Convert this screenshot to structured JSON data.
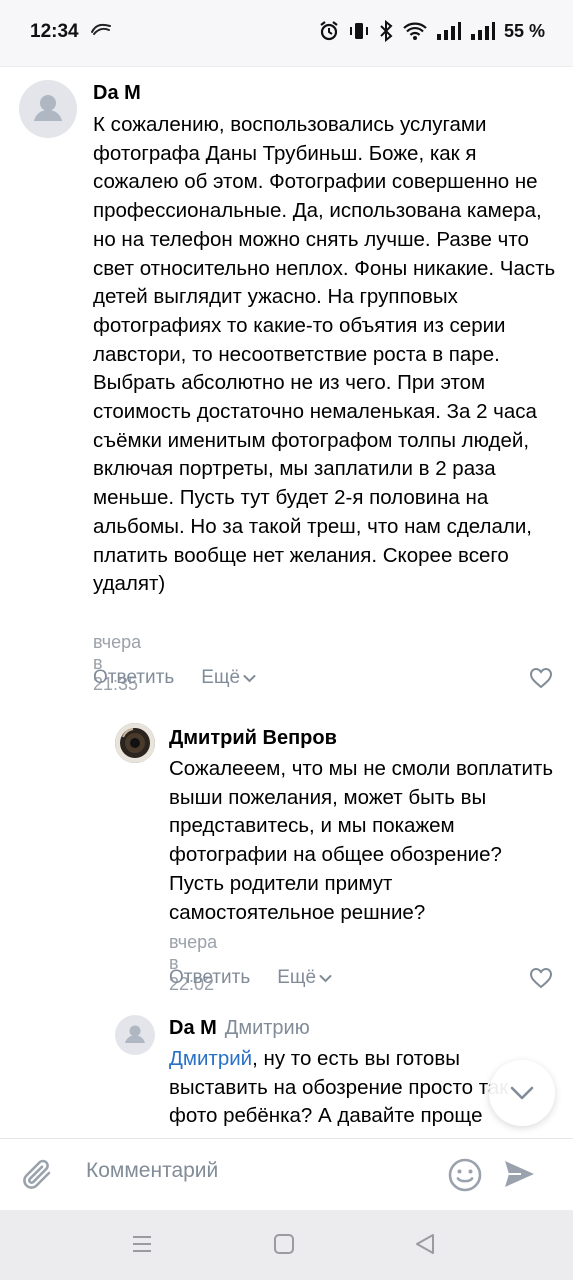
{
  "status_bar": {
    "time": "12:34",
    "battery": "55 %"
  },
  "comments": [
    {
      "author": "Da M",
      "text": "К сожалению, воспользовались услугами фотографа Даны Трубиньш. Боже, как я сожалею об этом. Фотографии совершенно не профессиональные. Да, использована камера, но на телефон можно снять лучше. Разве что свет относительно неплох. Фоны никакие. Часть детей выглядит ужасно. На групповых фотографиях то какие-то объятия из серии лавстори, то несоответствие роста в паре. Выбрать абсолютно не из чего. При этом стоимость достаточно немаленькая. За 2 часа съёмки именитым фотографом толпы людей, включая портреты, мы заплатили в 2 раза меньше. Пусть тут будет 2-я половина на альбомы. Но за такой треш, что нам сделали, платить вообще нет желания. Скорее всего удалят)",
      "time": "вчера в 21:35",
      "reply_label": "Ответить",
      "more_label": "Ещё"
    },
    {
      "author": "Дмитрий Вепров",
      "text": "Сожалееем, что мы не смоли воплатить выши пожелания, может быть вы представитесь, и мы покажем фотографии на общее обозрение? Пусть родители примут самостоятельное решние?",
      "time": "вчера в 22:02",
      "reply_label": "Ответить",
      "more_label": "Ещё"
    },
    {
      "author": "Da M",
      "reply_to": "Дмитрию",
      "mention": "Дмитрий",
      "text": ", ну то есть вы готовы выставить на обозрение просто так фото ребёнка? А давайте проще"
    }
  ],
  "input": {
    "placeholder": "Комментарий"
  },
  "icons": {
    "attach": "paperclip-icon",
    "emoji": "smile-icon",
    "send": "send-icon",
    "like": "heart-icon",
    "scroll": "chevron-down-icon"
  },
  "colors": {
    "accent": "#2a71c6",
    "secondary_text": "#818c99",
    "avatar_bg": "#e3e5ea"
  }
}
